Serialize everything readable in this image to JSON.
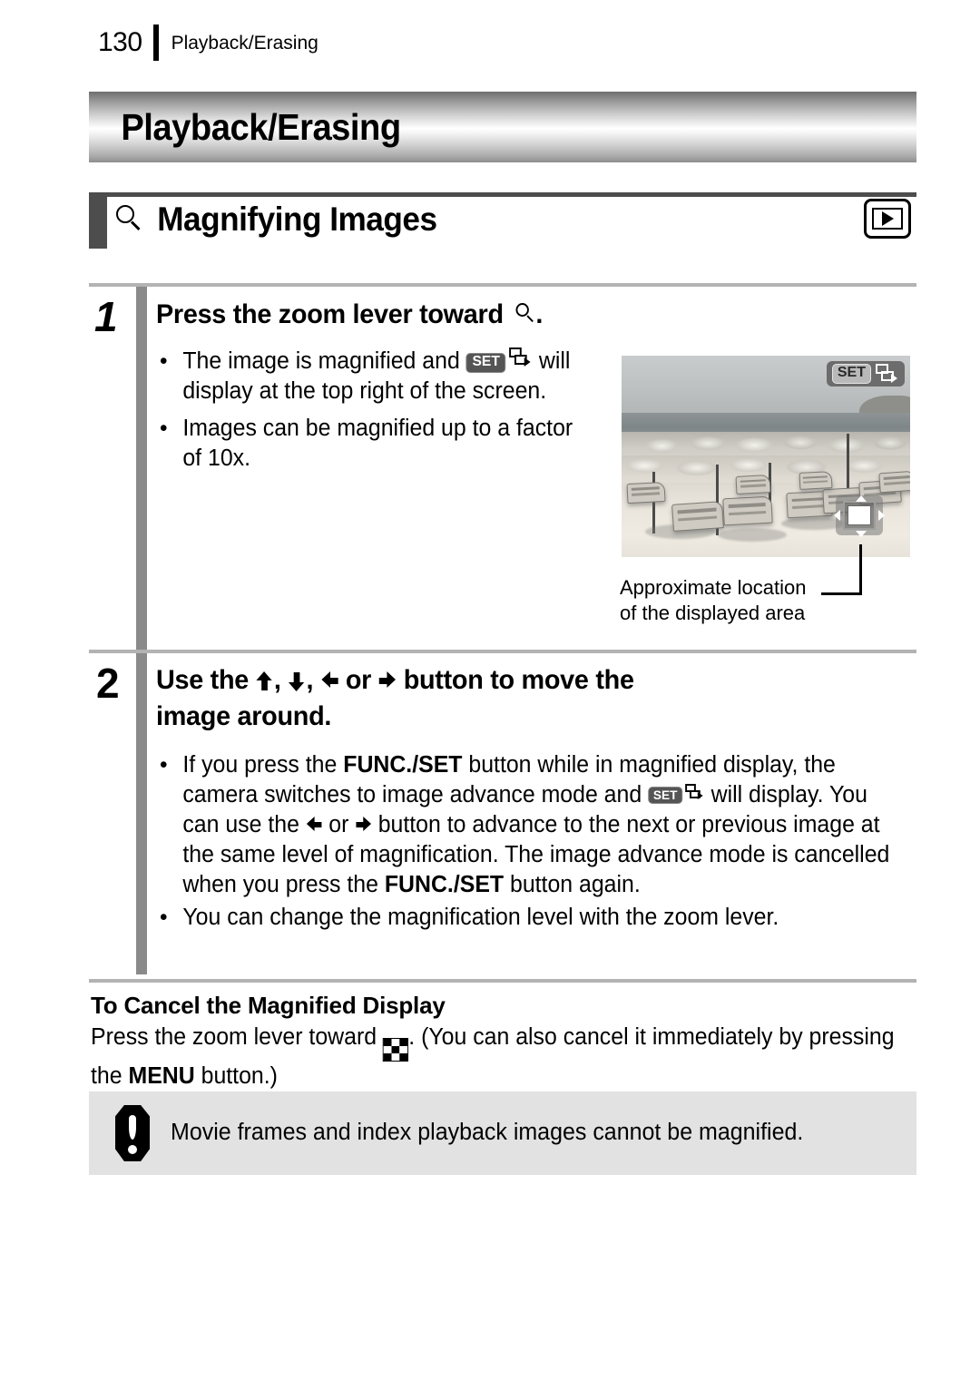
{
  "running_header": {
    "page_number": "130",
    "chapter": "Playback/Erasing"
  },
  "banner": {
    "title": "Playback/Erasing"
  },
  "section": {
    "icon": "magnifier-icon",
    "title": "Magnifying Images",
    "mode_icon": "playback-mode-icon"
  },
  "steps": [
    {
      "number": "1",
      "heading_before": "Press the zoom lever toward",
      "heading_icon": "magnifier-icon",
      "heading_after": ".",
      "bullets": [
        {
          "parts_1": "The image is magnified and",
          "icon_set": "SET",
          "icon_advance": "image-advance-icon",
          "parts_2": "will display at the top right of the screen."
        },
        {
          "text": "Images can be magnified up to a factor of 10x."
        }
      ]
    },
    {
      "number": "2",
      "heading": "Use the ↑, ↓, ← or → button to move the image around.",
      "heading_line1_a": "Use the",
      "heading_line1_b": ",",
      "heading_line1_c": ",",
      "heading_line1_d": "or",
      "heading_line1_e": "button to move the",
      "heading_line2": "image around.",
      "bullets": [
        {
          "seg1": "If you press the ",
          "bold1": "FUNC./SET",
          "seg2": " button while in magnified display, the camera switches to image advance mode and ",
          "icon_set": "SET",
          "icon_advance": "image-advance-icon",
          "seg3": " will display. You can use the ",
          "icon_left": "left-arrow-icon",
          "seg4": " or ",
          "icon_right": "right-arrow-icon",
          "seg5": " button to advance to the next or previous image at the same level of magnification. The image advance mode is cancelled when you press the ",
          "bold2": "FUNC./SET",
          "seg6": " button again."
        },
        {
          "text": "You can change the magnification level with the zoom lever."
        }
      ]
    }
  ],
  "figure": {
    "set_badge": "SET",
    "advance_icon": "image-advance-icon",
    "caption_line1": "Approximate location",
    "caption_line2": "of the displayed area",
    "location_indicator": "displayed-area-indicator"
  },
  "cancel_section": {
    "heading": "To Cancel the Magnified Display",
    "text_before_icon": "Press the zoom lever toward",
    "index_icon": "index-playback-icon",
    "text_after_icon": ". (You can also cancel it immediately by pressing the",
    "menu_bold": "MENU",
    "text_end": "button.)"
  },
  "note": {
    "icon": "caution-icon",
    "text": "Movie frames and index playback images cannot be magnified."
  },
  "colors": {
    "banner_dark": "#6e6e6e",
    "banner_light": "#ffffff",
    "section_bar": "#4d4d4d",
    "rule": "#b3b3b3",
    "step_bar": "#8a8a8a",
    "note_bg": "#e2e2e2"
  }
}
